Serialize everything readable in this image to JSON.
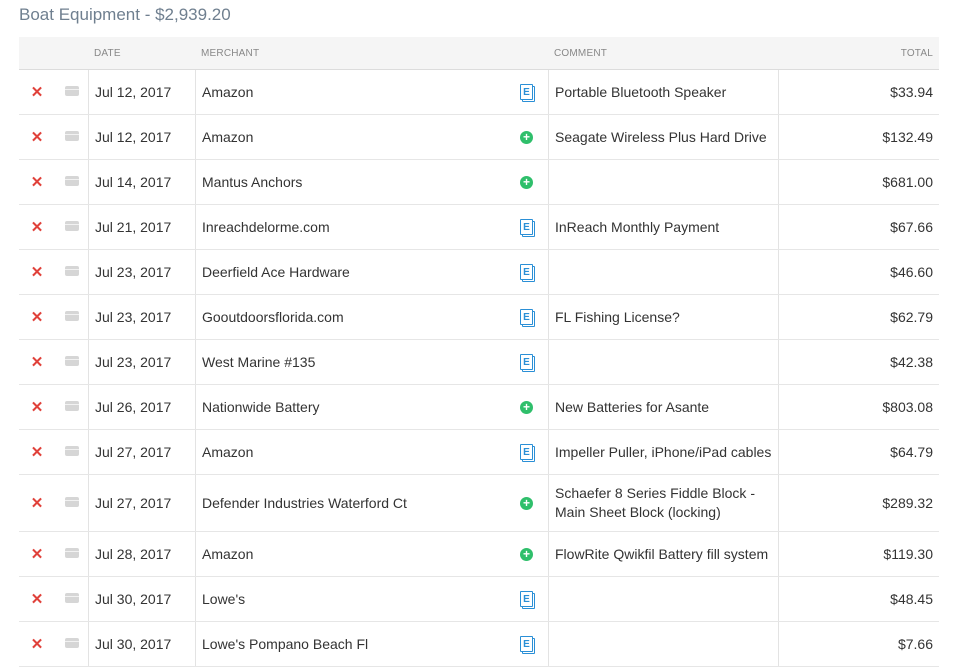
{
  "report": {
    "title": "Boat Equipment - $2,939.20"
  },
  "columns": {
    "date": "DATE",
    "merchant": "MERCHANT",
    "comment": "COMMENT",
    "total": "TOTAL"
  },
  "icons": {
    "delete": "x-icon",
    "card": "credit-card-icon",
    "receipt": "receipt-icon",
    "add": "add-receipt-icon"
  },
  "colors": {
    "delete": "#e0413a",
    "receipt": "#2a8fd6",
    "add": "#2fbf6b",
    "title": "#6f7f8f"
  },
  "expenses": [
    {
      "date": "Jul 12, 2017",
      "merchant": "Amazon",
      "receipt": "receipt",
      "comment": "Portable Bluetooth Speaker",
      "total": "$33.94"
    },
    {
      "date": "Jul 12, 2017",
      "merchant": "Amazon",
      "receipt": "add",
      "comment": "Seagate Wireless Plus Hard Drive",
      "total": "$132.49"
    },
    {
      "date": "Jul 14, 2017",
      "merchant": "Mantus Anchors",
      "receipt": "add",
      "comment": "",
      "total": "$681.00"
    },
    {
      "date": "Jul 21, 2017",
      "merchant": "Inreachdelorme.com",
      "receipt": "receipt",
      "comment": "InReach Monthly Payment",
      "total": "$67.66"
    },
    {
      "date": "Jul 23, 2017",
      "merchant": "Deerfield Ace Hardware",
      "receipt": "receipt",
      "comment": "",
      "total": "$46.60"
    },
    {
      "date": "Jul 23, 2017",
      "merchant": "Gooutdoorsflorida.com",
      "receipt": "receipt",
      "comment": "FL Fishing License?",
      "total": "$62.79"
    },
    {
      "date": "Jul 23, 2017",
      "merchant": "West Marine #135",
      "receipt": "receipt",
      "comment": "",
      "total": "$42.38"
    },
    {
      "date": "Jul 26, 2017",
      "merchant": "Nationwide Battery",
      "receipt": "add",
      "comment": "New Batteries for Asante",
      "total": "$803.08"
    },
    {
      "date": "Jul 27, 2017",
      "merchant": "Amazon",
      "receipt": "receipt",
      "comment": "Impeller Puller, iPhone/iPad cables",
      "total": "$64.79"
    },
    {
      "date": "Jul 27, 2017",
      "merchant": "Defender Industries Waterford Ct",
      "receipt": "add",
      "comment": "Schaefer 8 Series Fiddle Block - Main Sheet Block (locking)",
      "total": "$289.32"
    },
    {
      "date": "Jul 28, 2017",
      "merchant": "Amazon",
      "receipt": "add",
      "comment": "FlowRite Qwikfil Battery fill system",
      "total": "$119.30"
    },
    {
      "date": "Jul 30, 2017",
      "merchant": "Lowe's",
      "receipt": "receipt",
      "comment": "",
      "total": "$48.45"
    },
    {
      "date": "Jul 30, 2017",
      "merchant": "Lowe's Pompano Beach Fl",
      "receipt": "receipt",
      "comment": "",
      "total": "$7.66"
    }
  ]
}
